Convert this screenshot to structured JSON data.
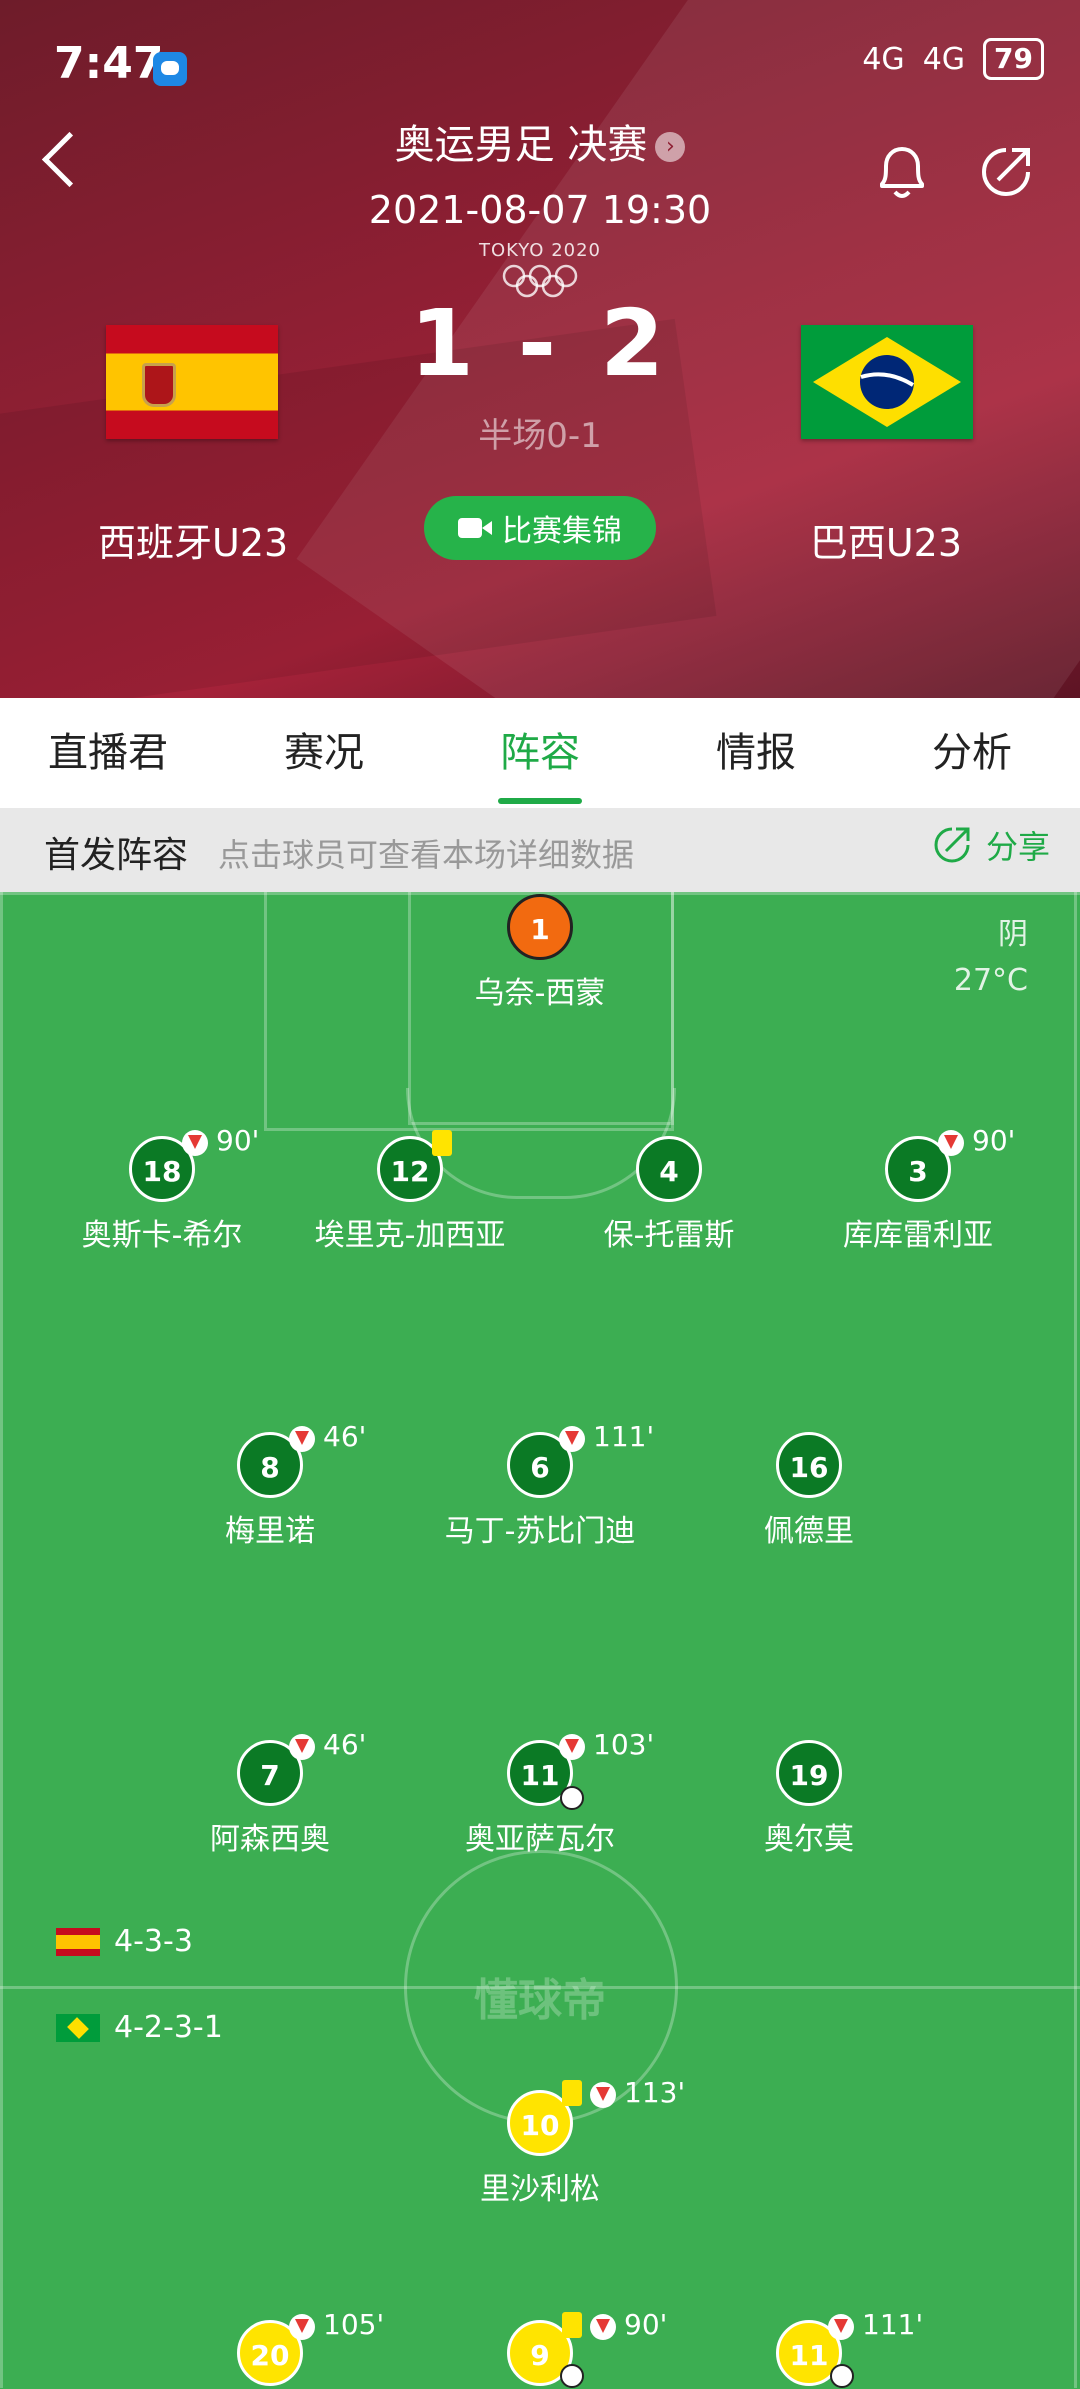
{
  "status": {
    "time": "7:47",
    "battery": "79",
    "network1": "4G",
    "network2": "4G"
  },
  "header": {
    "title": "奥运男足 决赛",
    "datetime": "2021-08-07 19:30",
    "olympic_text": "TOKYO 2020",
    "home": {
      "name": "西班牙U23"
    },
    "away": {
      "name": "巴西U23"
    },
    "score": "1 - 2",
    "halftime": "半场0-1",
    "highlights_label": "比赛集锦"
  },
  "tabs": [
    "直播君",
    "赛况",
    "阵容",
    "情报",
    "分析"
  ],
  "active_tab": "阵容",
  "lineup": {
    "title": "首发阵容",
    "hint": "点击球员可查看本场详细数据",
    "share": "分享",
    "weather": "阴",
    "temperature": "27°C",
    "watermark": "懂球帝",
    "formation_home": "4-3-3",
    "formation_away": "4-2-3-1"
  },
  "players": {
    "gk": {
      "number": "1",
      "name": "乌奈-西蒙"
    },
    "d1": {
      "number": "18",
      "name": "奥斯卡-希尔",
      "sub": "90'"
    },
    "d2": {
      "number": "12",
      "name": "埃里克-加西亚"
    },
    "d3": {
      "number": "4",
      "name": "保-托雷斯"
    },
    "d4": {
      "number": "3",
      "name": "库库雷利亚",
      "sub": "90'"
    },
    "m1": {
      "number": "8",
      "name": "梅里诺",
      "sub": "46'"
    },
    "m2": {
      "number": "6",
      "name": "马丁-苏比门迪",
      "sub": "111'"
    },
    "m3": {
      "number": "16",
      "name": "佩德里"
    },
    "f1": {
      "number": "7",
      "name": "阿森西奥",
      "sub": "46'"
    },
    "f2": {
      "number": "11",
      "name": "奥亚萨瓦尔",
      "sub": "103'"
    },
    "f3": {
      "number": "19",
      "name": "奥尔莫"
    },
    "a1": {
      "number": "10",
      "name": "里沙利松",
      "sub": "113'"
    },
    "a2": {
      "number": "20",
      "sub": "105'"
    },
    "a3": {
      "number": "9",
      "sub": "90'"
    },
    "a4": {
      "number": "11",
      "sub": "111'"
    }
  },
  "colors": {
    "accent": "#1faa47",
    "pitch": "#3cae52",
    "home_disc": "#0b7a25",
    "away_disc": "#ffe400",
    "keeper_disc": "#f26a10"
  }
}
